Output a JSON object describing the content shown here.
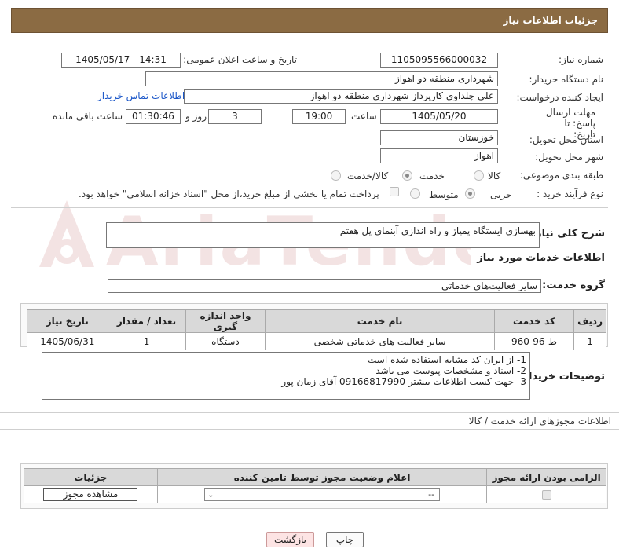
{
  "header": {
    "title": "جزئیات اطلاعات نیاز"
  },
  "form": {
    "need_number_label": "شماره نیاز:",
    "need_number": "1105095566000032",
    "announce_label": "تاریخ و ساعت اعلان عمومی:",
    "announce_value": "1405/05/17 - 14:31",
    "buyer_org_label": "نام دستگاه خریدار:",
    "buyer_org": "شهرداری منطقه دو اهواز",
    "creator_label": "ایجاد کننده درخواست:",
    "creator": "علی چلداوی کارپرداز شهرداری منطقه دو اهواز",
    "contact_link": "اطلاعات تماس خریدار",
    "deadline_label": "مهلت ارسال پاسخ: تا تاریخ:",
    "deadline_date": "1405/05/20",
    "time_label": "ساعت",
    "deadline_time": "19:00",
    "days_value": "3",
    "days_label": "روز و",
    "remaining_time": "01:30:46",
    "remaining_label": "ساعت باقی مانده",
    "province_label": "استان محل تحویل:",
    "province": "خوزستان",
    "city_label": "شهر محل تحویل:",
    "city": "اهواز",
    "category_label": "طبقه بندی موضوعی:",
    "category_options": [
      "کالا",
      "خدمت",
      "کالا/خدمت"
    ],
    "category_selected": "خدمت",
    "process_label": "نوع فرآیند خرید :",
    "process_options": [
      "جزیی",
      "متوسط"
    ],
    "process_selected": "جزیی",
    "payment_note": "پرداخت تمام یا بخشی از مبلغ خرید،از محل \"اسناد خزانه اسلامی\" خواهد بود."
  },
  "watermark": {
    "text": "AriaTender.net"
  },
  "summary": {
    "label": "شرح کلی نیاز:",
    "text": "بهسازی ایستگاه پمپاژ و راه اندازی آبنمای پل هفتم"
  },
  "services": {
    "heading": "اطلاعات خدمات مورد نیاز",
    "group_label": "گروه خدمت:",
    "group_value": "سایر فعالیت‌های خدماتی",
    "columns": [
      "ردیف",
      "کد خدمت",
      "نام خدمت",
      "واحد اندازه گیری",
      "تعداد / مقدار",
      "تاریخ نیاز"
    ],
    "rows": [
      [
        "1",
        "ط-96-960",
        "سایر فعالیت های خدماتی شخصی",
        "دستگاه",
        "1",
        "1405/06/31"
      ]
    ]
  },
  "buyer_notes": {
    "label": "توضیحات خریدار:",
    "lines": [
      "1- از ایران کد مشابه استفاده شده است",
      "2- اسناد و مشخصات پیوست می باشد",
      "3- جهت کسب اطلاعات بیشتر 09166817990 آقای زمان پور"
    ]
  },
  "permits": {
    "heading": "اطلاعات مجوزهای ارائه خدمت / کالا",
    "columns": [
      "الزامی بودن ارائه مجوز",
      "اعلام وضعیت مجوز توسط تامین کننده",
      "جزئیات"
    ],
    "select_value": "--",
    "view_button": "مشاهده مجوز"
  },
  "actions": {
    "print": "چاپ",
    "back": "بازگشت"
  }
}
